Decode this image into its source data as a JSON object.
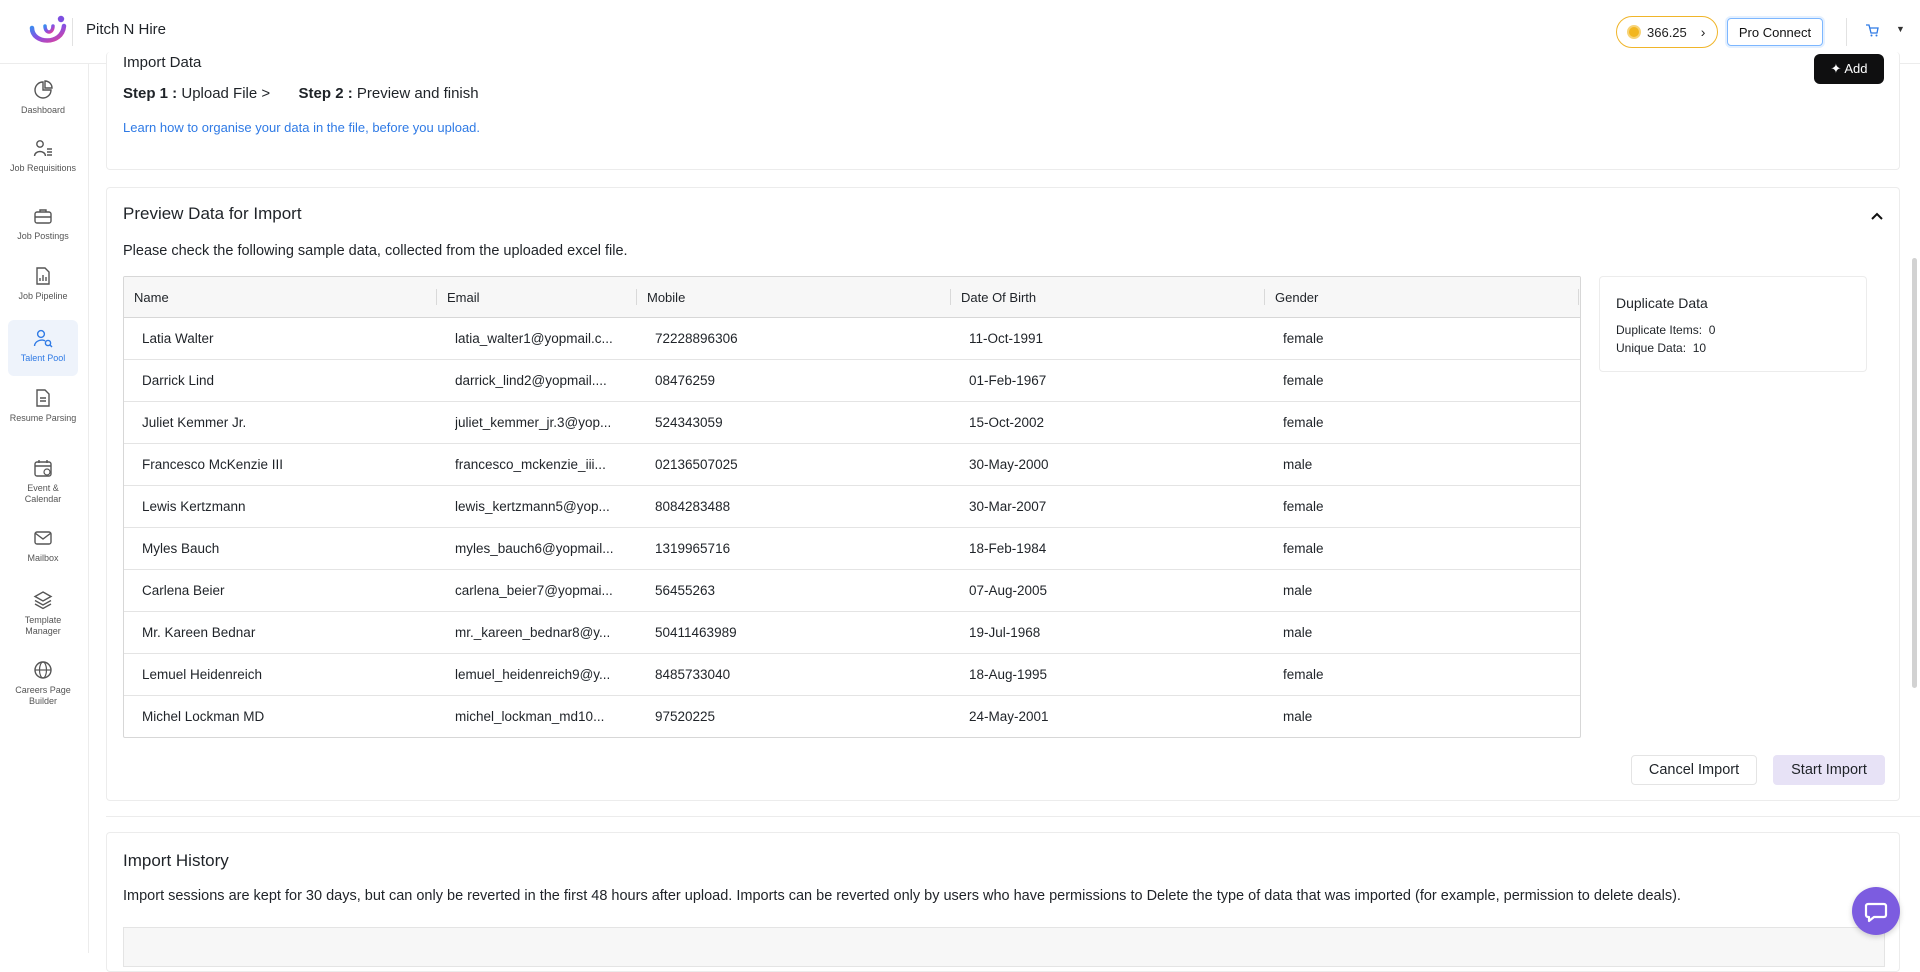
{
  "brand": {
    "name": "Pitch N Hire"
  },
  "header": {
    "coins": "366.25",
    "pro_connect": "Pro Connect"
  },
  "sidebar": {
    "items": [
      {
        "label": "Dashboard",
        "icon": "pie-chart-icon"
      },
      {
        "label": "Job Requisitions",
        "icon": "user-list-icon"
      },
      {
        "label": "Job Postings",
        "icon": "briefcase-icon"
      },
      {
        "label": "Job Pipeline",
        "icon": "document-chart-icon"
      },
      {
        "label": "Talent Pool",
        "icon": "user-search-icon",
        "active": true
      },
      {
        "label": "Resume Parsing",
        "icon": "document-icon"
      },
      {
        "label": "Event & Calendar",
        "icon": "calendar-icon"
      },
      {
        "label": "Mailbox",
        "icon": "mail-icon"
      },
      {
        "label": "Template Manager",
        "icon": "layers-icon"
      },
      {
        "label": "Careers Page Builder",
        "icon": "globe-icon"
      }
    ]
  },
  "import_data": {
    "title": "Import Data",
    "step1_label": "Step 1 :",
    "step1_text": "Upload File >",
    "step2_label": "Step 2 :",
    "step2_text": "Preview and finish",
    "learn_link": "Learn how to organise your data in the file, before you upload.",
    "add_button": "Add"
  },
  "preview": {
    "title": "Preview Data for Import",
    "description": "Please check the following sample data, collected from the uploaded excel file.",
    "columns": [
      "Name",
      "Email",
      "Mobile",
      "Date Of Birth",
      "Gender"
    ],
    "rows": [
      [
        "Latia Walter",
        "latia_walter1@yopmail.c...",
        "72228896306",
        "11-Oct-1991",
        "female"
      ],
      [
        "Darrick Lind",
        "darrick_lind2@yopmail....",
        "08476259",
        "01-Feb-1967",
        "female"
      ],
      [
        "Juliet Kemmer Jr.",
        "juliet_kemmer_jr.3@yop...",
        "524343059",
        "15-Oct-2002",
        "female"
      ],
      [
        "Francesco McKenzie III",
        "francesco_mckenzie_iii...",
        "02136507025",
        "30-May-2000",
        "male"
      ],
      [
        "Lewis Kertzmann",
        "lewis_kertzmann5@yop...",
        "8084283488",
        "30-Mar-2007",
        "female"
      ],
      [
        "Myles Bauch",
        "myles_bauch6@yopmail...",
        "1319965716",
        "18-Feb-1984",
        "female"
      ],
      [
        "Carlena Beier",
        "carlena_beier7@yopmai...",
        "56455263",
        "07-Aug-2005",
        "male"
      ],
      [
        "Mr. Kareen Bednar",
        "mr._kareen_bednar8@y...",
        "50411463989",
        "19-Jul-1968",
        "male"
      ],
      [
        "Lemuel Heidenreich",
        "lemuel_heidenreich9@y...",
        "8485733040",
        "18-Aug-1995",
        "female"
      ],
      [
        "Michel Lockman MD",
        "michel_lockman_md10...",
        "97520225",
        "24-May-2001",
        "male"
      ]
    ],
    "duplicate": {
      "title": "Duplicate Data",
      "duplicate_label": "Duplicate Items:",
      "duplicate_value": "0",
      "unique_label": "Unique Data:",
      "unique_value": "10"
    },
    "cancel_button": "Cancel Import",
    "start_button": "Start Import"
  },
  "history": {
    "title": "Import History",
    "description": "Import sessions are kept for 30 days, but can only be reverted in the first 48 hours after upload. Imports can be reverted only by users who have permissions to Delete the type of data that was imported (for example, permission to delete deals)."
  },
  "colors": {
    "accent": "#2f7ae5",
    "coin": "#f2b61f",
    "chat": "#7c5ce0",
    "start_button_bg": "#e7e2f6"
  }
}
